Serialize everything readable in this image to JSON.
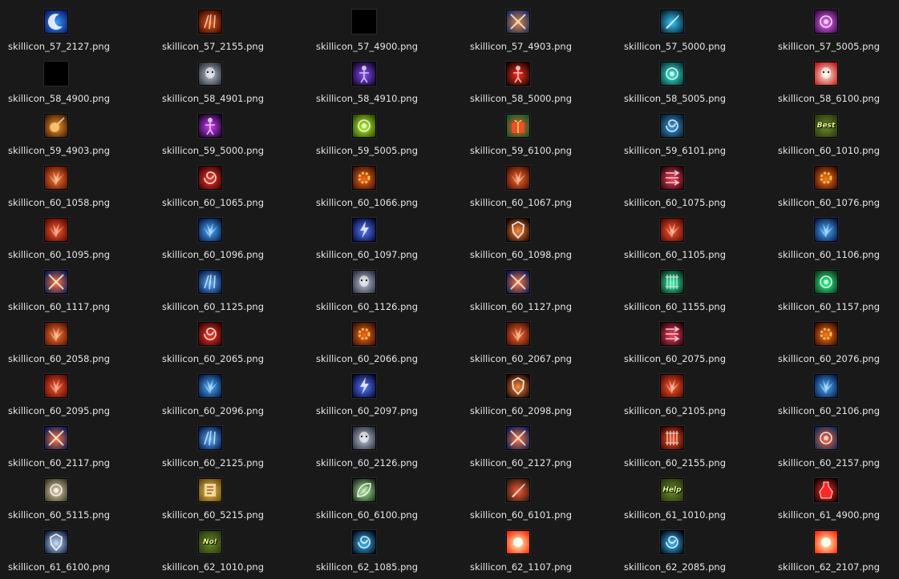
{
  "files": [
    {
      "name": "skillicon_57_2127.png",
      "icon": "blue-crescent-icon",
      "c1": "#0b1a6e",
      "c2": "#3aa0ff",
      "glyph": "crescent"
    },
    {
      "name": "skillicon_57_2155.png",
      "icon": "fire-lion-icon",
      "c1": "#3a0a02",
      "c2": "#e85a18",
      "glyph": "claws"
    },
    {
      "name": "skillicon_57_4900.png",
      "icon": "black-empty-icon",
      "c1": "#000000",
      "c2": "#000000",
      "glyph": "none"
    },
    {
      "name": "skillicon_57_4903.png",
      "icon": "crossed-swords-icon",
      "c1": "#1a2a66",
      "c2": "#e08a3a",
      "glyph": "swords"
    },
    {
      "name": "skillicon_57_5000.png",
      "icon": "blue-sword-icon",
      "c1": "#06202e",
      "c2": "#38c8ff",
      "glyph": "blade"
    },
    {
      "name": "skillicon_57_5005.png",
      "icon": "purple-orb-icon",
      "c1": "#3a0a4a",
      "c2": "#f06cff",
      "glyph": "orb"
    },
    {
      "name": "skillicon_58_4900.png",
      "icon": "black-empty-icon",
      "c1": "#000000",
      "c2": "#000000",
      "glyph": "none"
    },
    {
      "name": "skillicon_58_4901.png",
      "icon": "grey-warrior-icon",
      "c1": "#2a2f36",
      "c2": "#b9c4d0",
      "glyph": "face"
    },
    {
      "name": "skillicon_58_4910.png",
      "icon": "purple-figure-icon",
      "c1": "#12062a",
      "c2": "#8a4cff",
      "glyph": "figure"
    },
    {
      "name": "skillicon_58_5000.png",
      "icon": "red-figure-icon",
      "c1": "#1a0202",
      "c2": "#ff3020",
      "glyph": "figure"
    },
    {
      "name": "skillicon_58_5005.png",
      "icon": "cyan-orb-icon",
      "c1": "#053a3a",
      "c2": "#40f0e0",
      "glyph": "orb"
    },
    {
      "name": "skillicon_58_6100.png",
      "icon": "santa-icon",
      "c1": "#c21a1a",
      "c2": "#fff4e0",
      "glyph": "face"
    },
    {
      "name": "skillicon_59_4903.png",
      "icon": "meteor-icon",
      "c1": "#3a1a06",
      "c2": "#ff9a2a",
      "glyph": "meteor"
    },
    {
      "name": "skillicon_59_5000.png",
      "icon": "magenta-figure-icon",
      "c1": "#1a0228",
      "c2": "#d040ff",
      "glyph": "figure"
    },
    {
      "name": "skillicon_59_5005.png",
      "icon": "green-orb-icon",
      "c1": "#2a4a06",
      "c2": "#c0ff30",
      "glyph": "orb"
    },
    {
      "name": "skillicon_59_6100.png",
      "icon": "gift-icon",
      "c1": "#0a5a2a",
      "c2": "#ff5a2a",
      "glyph": "gift"
    },
    {
      "name": "skillicon_59_6101.png",
      "icon": "blue-bird-icon",
      "c1": "#082030",
      "c2": "#3aa0e8",
      "glyph": "swirl"
    },
    {
      "name": "skillicon_60_1010.png",
      "icon": "best-badge-icon",
      "c1": "#2a3a10",
      "c2": "#6a8a2a",
      "glyph": "text",
      "tag": "Best"
    },
    {
      "name": "skillicon_60_1058.png",
      "icon": "flame-burst-icon",
      "c1": "#5a1204",
      "c2": "#ff7a30",
      "glyph": "burst"
    },
    {
      "name": "skillicon_60_1065.png",
      "icon": "red-swirl-icon",
      "c1": "#3a0202",
      "c2": "#ff3a2a",
      "glyph": "swirl"
    },
    {
      "name": "skillicon_60_1066.png",
      "icon": "fire-gear-icon",
      "c1": "#3a1204",
      "c2": "#ff6a1a",
      "glyph": "gear"
    },
    {
      "name": "skillicon_60_1067.png",
      "icon": "flame-burst-icon",
      "c1": "#4a1006",
      "c2": "#ff6a2a",
      "glyph": "burst"
    },
    {
      "name": "skillicon_60_1075.png",
      "icon": "red-arrows-icon",
      "c1": "#2a0408",
      "c2": "#ff4060",
      "glyph": "arrows"
    },
    {
      "name": "skillicon_60_1076.png",
      "icon": "fire-circle-icon",
      "c1": "#3a0a02",
      "c2": "#ff7a1a",
      "glyph": "gear"
    },
    {
      "name": "skillicon_60_1095.png",
      "icon": "fire-explosion-icon",
      "c1": "#5a0a04",
      "c2": "#ff5a2a",
      "glyph": "burst"
    },
    {
      "name": "skillicon_60_1096.png",
      "icon": "ice-explosion-icon",
      "c1": "#061a4a",
      "c2": "#4ab0ff",
      "glyph": "burst"
    },
    {
      "name": "skillicon_60_1097.png",
      "icon": "lightning-icon",
      "c1": "#040a3a",
      "c2": "#5a7aff",
      "glyph": "bolt"
    },
    {
      "name": "skillicon_60_1098.png",
      "icon": "shield-icon",
      "c1": "#1a0402",
      "c2": "#ff8a3a",
      "glyph": "shield"
    },
    {
      "name": "skillicon_60_1105.png",
      "icon": "fire-explosion-icon",
      "c1": "#5a0a04",
      "c2": "#ff5a2a",
      "glyph": "burst"
    },
    {
      "name": "skillicon_60_1106.png",
      "icon": "ice-explosion-icon",
      "c1": "#061a4a",
      "c2": "#4ab0ff",
      "glyph": "burst"
    },
    {
      "name": "skillicon_60_1117.png",
      "icon": "rune-circle-icon",
      "c1": "#0a1a5a",
      "c2": "#ff7a3a",
      "glyph": "swords"
    },
    {
      "name": "skillicon_60_1125.png",
      "icon": "blue-claws-icon",
      "c1": "#061a4a",
      "c2": "#5ab0ff",
      "glyph": "claws"
    },
    {
      "name": "skillicon_60_1126.png",
      "icon": "stone-golem-icon",
      "c1": "#2a3040",
      "c2": "#c0c8d8",
      "glyph": "face"
    },
    {
      "name": "skillicon_60_1127.png",
      "icon": "rune-circle-icon",
      "c1": "#0a1a5a",
      "c2": "#ff7a3a",
      "glyph": "swords"
    },
    {
      "name": "skillicon_60_1155.png",
      "icon": "green-cage-icon",
      "c1": "#062a1a",
      "c2": "#3affb0",
      "glyph": "cage"
    },
    {
      "name": "skillicon_60_1157.png",
      "icon": "green-helm-icon",
      "c1": "#063a1a",
      "c2": "#3aff9a",
      "glyph": "orb"
    },
    {
      "name": "skillicon_60_2058.png",
      "icon": "flame-burst-icon",
      "c1": "#5a1204",
      "c2": "#ff7a30",
      "glyph": "burst"
    },
    {
      "name": "skillicon_60_2065.png",
      "icon": "red-swirl-icon",
      "c1": "#3a0202",
      "c2": "#ff3a2a",
      "glyph": "swirl"
    },
    {
      "name": "skillicon_60_2066.png",
      "icon": "fire-gear-icon",
      "c1": "#3a1204",
      "c2": "#ff6a1a",
      "glyph": "gear"
    },
    {
      "name": "skillicon_60_2067.png",
      "icon": "flame-burst-icon",
      "c1": "#4a1006",
      "c2": "#ff6a2a",
      "glyph": "burst"
    },
    {
      "name": "skillicon_60_2075.png",
      "icon": "red-arrows-icon",
      "c1": "#2a0408",
      "c2": "#ff4060",
      "glyph": "arrows"
    },
    {
      "name": "skillicon_60_2076.png",
      "icon": "fire-circle-icon",
      "c1": "#3a0a02",
      "c2": "#ff7a1a",
      "glyph": "gear"
    },
    {
      "name": "skillicon_60_2095.png",
      "icon": "fire-explosion-icon",
      "c1": "#5a0a04",
      "c2": "#ff5a2a",
      "glyph": "burst"
    },
    {
      "name": "skillicon_60_2096.png",
      "icon": "ice-explosion-icon",
      "c1": "#061a4a",
      "c2": "#4ab0ff",
      "glyph": "burst"
    },
    {
      "name": "skillicon_60_2097.png",
      "icon": "lightning-icon",
      "c1": "#040a3a",
      "c2": "#5a7aff",
      "glyph": "bolt"
    },
    {
      "name": "skillicon_60_2098.png",
      "icon": "shield-icon",
      "c1": "#1a0402",
      "c2": "#ff8a3a",
      "glyph": "shield"
    },
    {
      "name": "skillicon_60_2105.png",
      "icon": "fire-explosion-icon",
      "c1": "#5a0a04",
      "c2": "#ff5a2a",
      "glyph": "burst"
    },
    {
      "name": "skillicon_60_2106.png",
      "icon": "ice-explosion-icon",
      "c1": "#061a4a",
      "c2": "#4ab0ff",
      "glyph": "burst"
    },
    {
      "name": "skillicon_60_2117.png",
      "icon": "rune-circle-icon",
      "c1": "#0a1a5a",
      "c2": "#ff7a3a",
      "glyph": "swords"
    },
    {
      "name": "skillicon_60_2125.png",
      "icon": "blue-claws-icon",
      "c1": "#061a4a",
      "c2": "#5ab0ff",
      "glyph": "claws"
    },
    {
      "name": "skillicon_60_2126.png",
      "icon": "stone-golem-icon",
      "c1": "#2a3040",
      "c2": "#c0c8d8",
      "glyph": "face"
    },
    {
      "name": "skillicon_60_2127.png",
      "icon": "rune-circle-icon",
      "c1": "#0a1a5a",
      "c2": "#ff7a3a",
      "glyph": "swords"
    },
    {
      "name": "skillicon_60_2155.png",
      "icon": "red-cage-icon",
      "c1": "#3a0602",
      "c2": "#ff5a2a",
      "glyph": "cage"
    },
    {
      "name": "skillicon_60_2157.png",
      "icon": "fire-helm-icon",
      "c1": "#0a2a5a",
      "c2": "#ff6a3a",
      "glyph": "orb"
    },
    {
      "name": "skillicon_60_5115.png",
      "icon": "scroll-seal-icon",
      "c1": "#3a3a2a",
      "c2": "#e8d8b0",
      "glyph": "orb"
    },
    {
      "name": "skillicon_60_5215.png",
      "icon": "parchment-icon",
      "c1": "#6a4a0a",
      "c2": "#f0c860",
      "glyph": "scroll"
    },
    {
      "name": "skillicon_60_6100.png",
      "icon": "leaf-icon",
      "c1": "#1a2a1a",
      "c2": "#b0f0a0",
      "glyph": "leaf"
    },
    {
      "name": "skillicon_60_6101.png",
      "icon": "firecracker-icon",
      "c1": "#2a1a0a",
      "c2": "#ff5a3a",
      "glyph": "blade"
    },
    {
      "name": "skillicon_61_1010.png",
      "icon": "help-badge-icon",
      "c1": "#2a3a10",
      "c2": "#6a8a2a",
      "glyph": "text",
      "tag": "Help"
    },
    {
      "name": "skillicon_61_4900.png",
      "icon": "potion-icon",
      "c1": "#1a0202",
      "c2": "#ff3030",
      "glyph": "potion"
    },
    {
      "name": "skillicon_61_6100.png",
      "icon": "sword-shield-icon",
      "c1": "#0a1a3a",
      "c2": "#c8e0ff",
      "glyph": "shield"
    },
    {
      "name": "skillicon_62_1010.png",
      "icon": "no-badge-icon",
      "c1": "#2a3a10",
      "c2": "#6a8a2a",
      "glyph": "text",
      "tag": "No!"
    },
    {
      "name": "skillicon_62_1085.png",
      "icon": "blue-eye-icon",
      "c1": "#020a1a",
      "c2": "#3ac0ff",
      "glyph": "swirl"
    },
    {
      "name": "skillicon_62_1107.png",
      "icon": "sun-burst-icon",
      "c1": "#ff2a0a",
      "c2": "#ffffc0",
      "glyph": "sun"
    },
    {
      "name": "skillicon_62_2085.png",
      "icon": "blue-eye-icon",
      "c1": "#020a1a",
      "c2": "#3ac0ff",
      "glyph": "swirl"
    },
    {
      "name": "skillicon_62_2107.png",
      "icon": "sun-burst-icon",
      "c1": "#ff2a0a",
      "c2": "#ffffc0",
      "glyph": "sun"
    }
  ]
}
